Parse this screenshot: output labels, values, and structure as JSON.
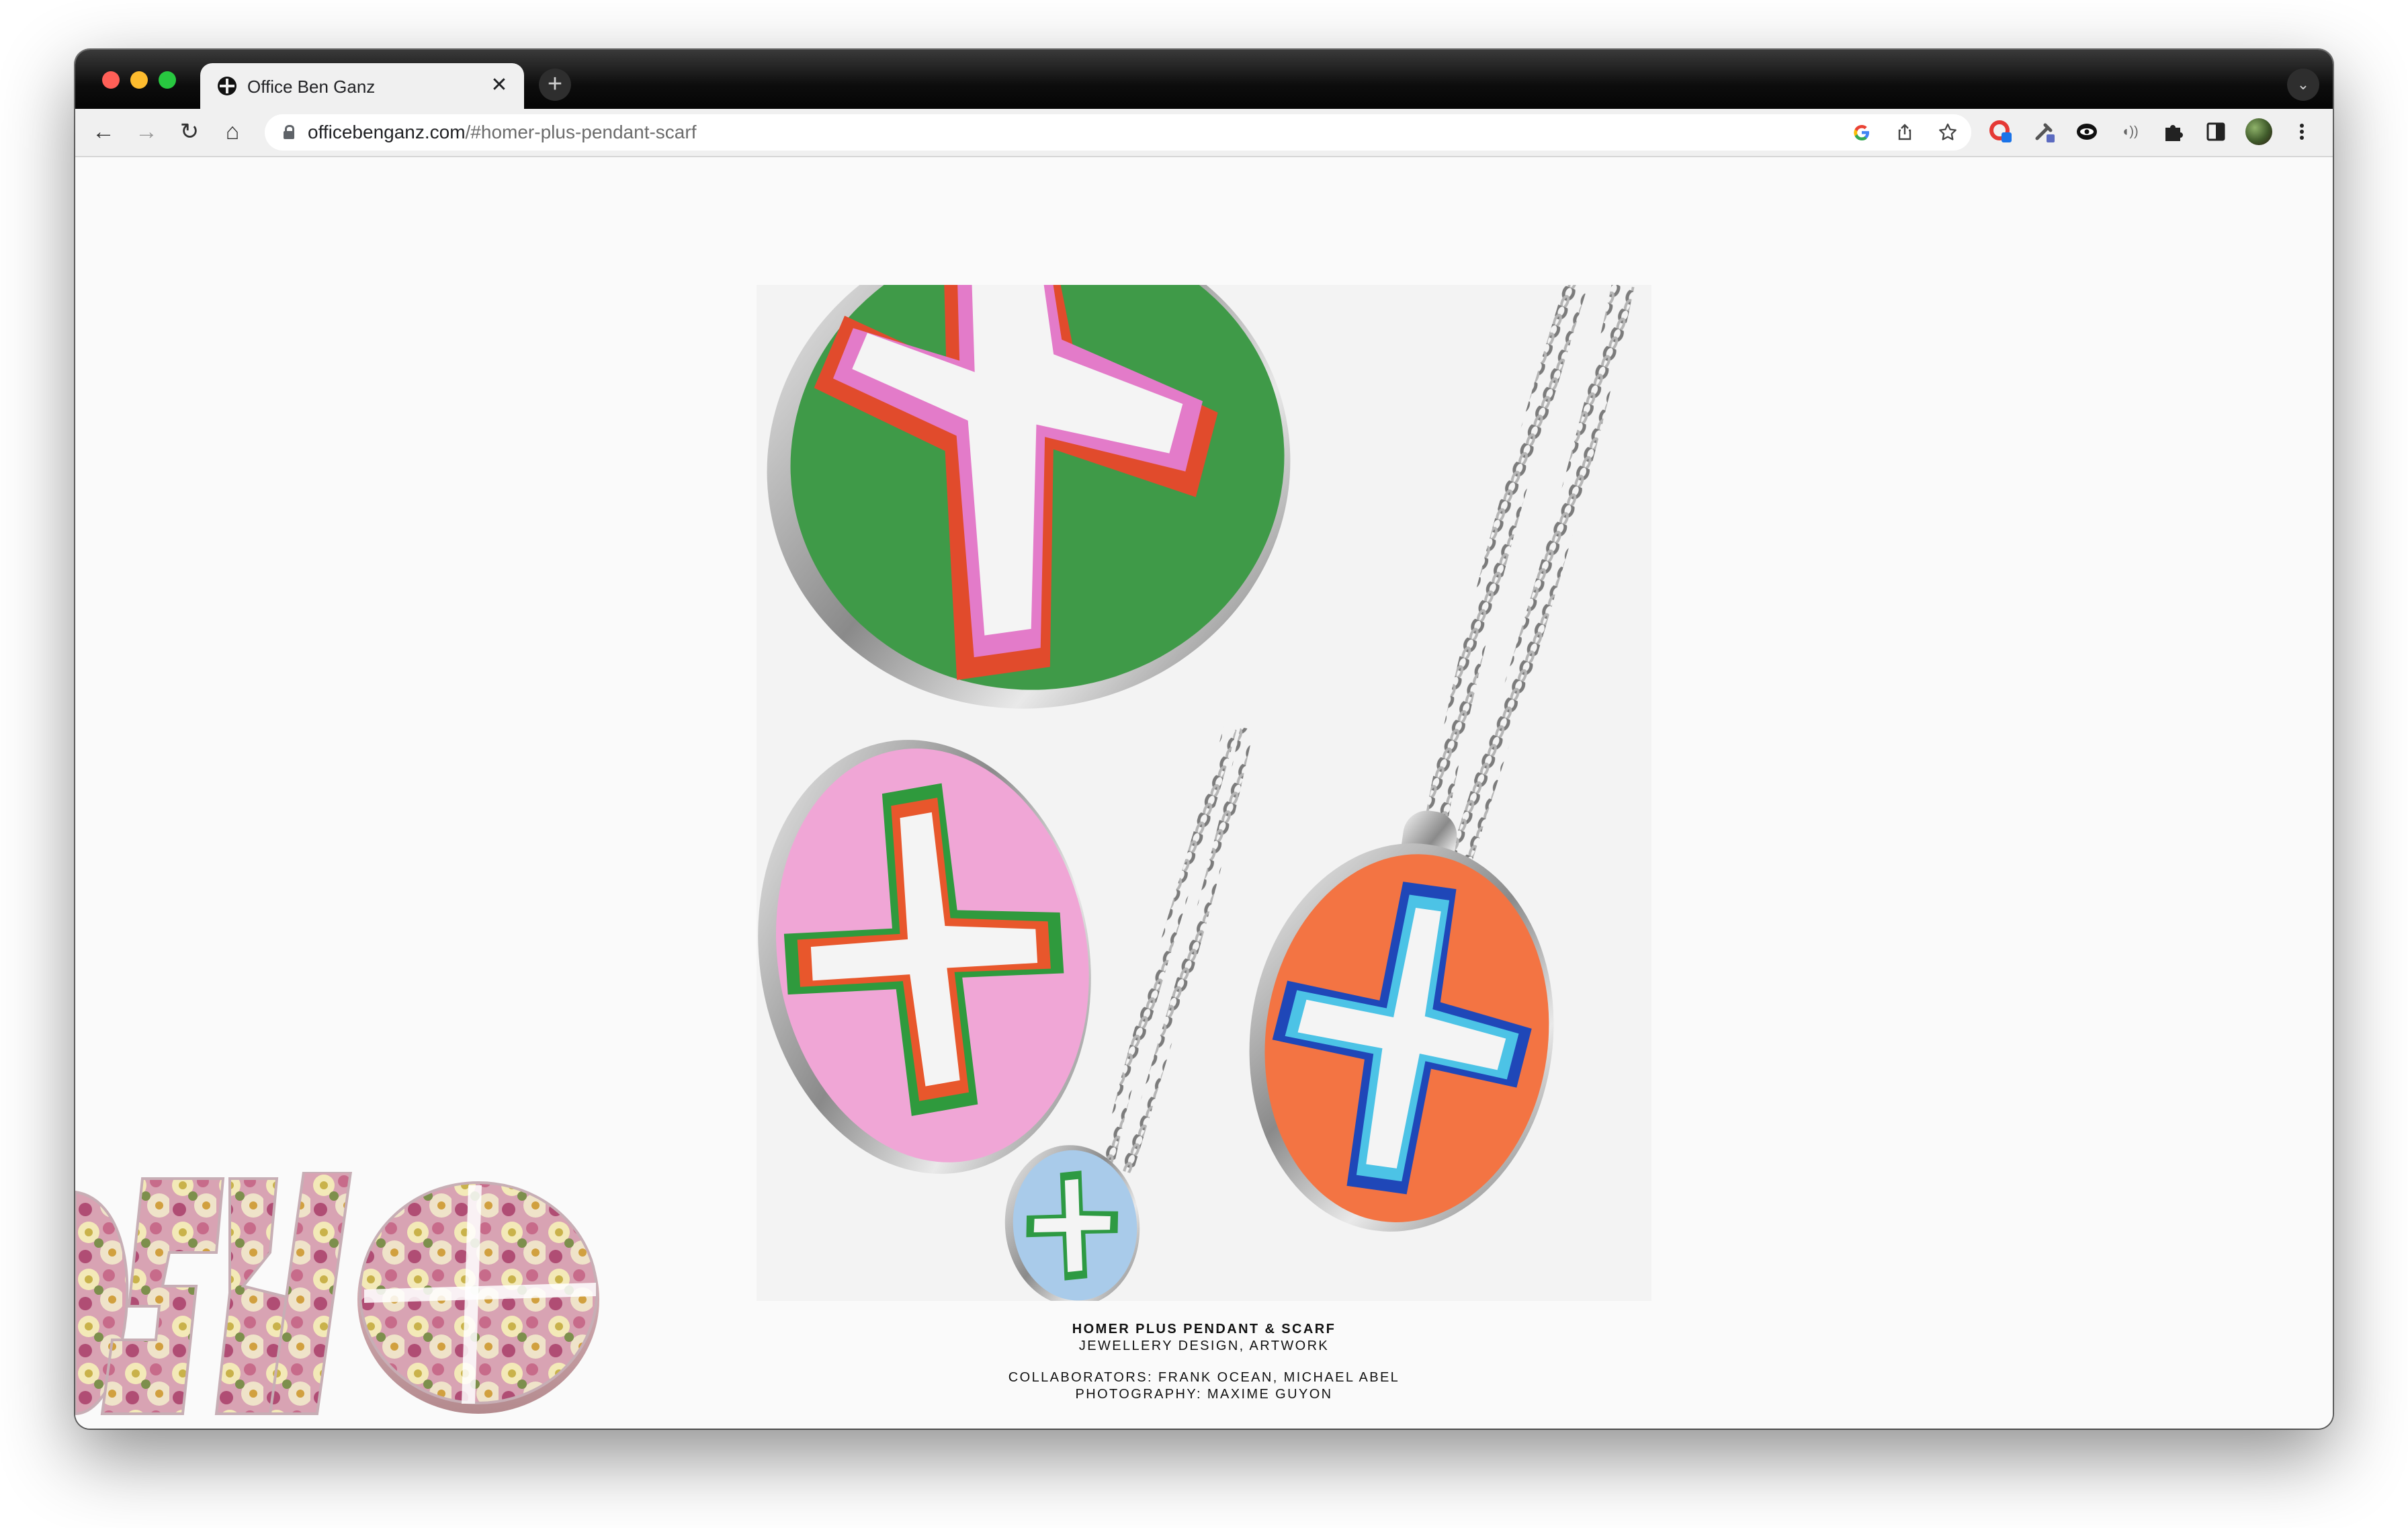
{
  "browser": {
    "tab": {
      "title": "Office Ben Ganz",
      "close_glyph": "✕",
      "favicon": "plus-circle-icon"
    },
    "new_tab_glyph": "+",
    "tab_search_glyph": "⌄",
    "nav": {
      "back": "←",
      "forward": "→",
      "reload": "↻",
      "home": "⌂"
    },
    "address": {
      "host": "officebenganz.com",
      "path": "/#homer-plus-pendant-scarf"
    },
    "omnibox_icons": [
      "google-icon",
      "share-icon",
      "star-icon"
    ],
    "extensions": [
      "red-extension-icon",
      "dropper-extension-icon",
      "eye-extension-icon",
      "sound-extension-icon",
      "puzzle-icon",
      "sidepanel-icon",
      "avatar",
      "menu-icon"
    ]
  },
  "project": {
    "title": "HOMER PLUS PENDANT & SCARF",
    "disciplines": "JEWELLERY DESIGN, ARTWORK",
    "collaborators": "COLLABORATORS: FRANK OCEAN, MICHAEL ABEL",
    "photography": "PHOTOGRAPHY: MAXIME GUYON"
  },
  "colors": {
    "pendant_green": "#3f9a48",
    "pendant_pink": "#f0a6d6",
    "pendant_orange": "#f37443",
    "pendant_blue": "#a9cbea",
    "silver": "#c9c9c9",
    "floral": "#e7c7cf"
  }
}
